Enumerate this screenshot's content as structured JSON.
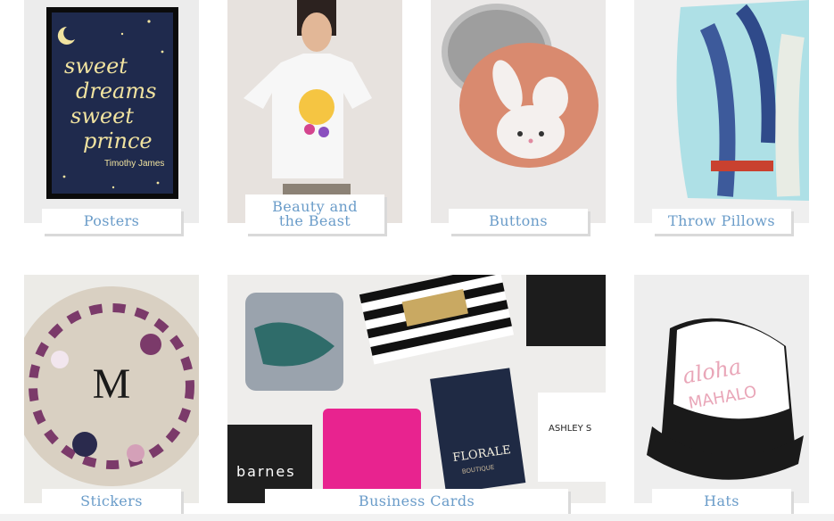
{
  "categories": [
    {
      "id": "posters",
      "label": "Posters",
      "poster_text": "sweet dreams sweet prince",
      "poster_name": "Timothy James"
    },
    {
      "id": "beauty",
      "label_line1": "Beauty and",
      "label_line2": "the Beast"
    },
    {
      "id": "buttons",
      "label": "Buttons"
    },
    {
      "id": "pillows",
      "label": "Throw Pillows"
    },
    {
      "id": "stickers",
      "label": "Stickers",
      "monogram": "M"
    },
    {
      "id": "cards",
      "label": "Business Cards",
      "card_texts": {
        "barnes": "barnes",
        "florale": "FLORALE",
        "boutique": "BOUTIQUE",
        "ashley": "ASHLEY S"
      }
    },
    {
      "id": "hats",
      "label": "Hats",
      "hat_text1": "aloha",
      "hat_text2": "MAHALO"
    }
  ],
  "colors": {
    "label_text": "#6a9cc9",
    "poster_bg": "#1f2a4d",
    "poster_text": "#f1e3a0",
    "button_orange": "#d98a6f",
    "pink_card": "#e8238f"
  }
}
